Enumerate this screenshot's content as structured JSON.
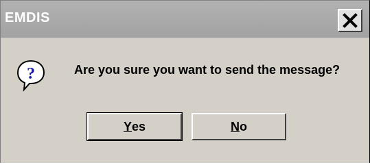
{
  "window": {
    "title": "EMDIS",
    "close_icon": "close-x-icon"
  },
  "message": {
    "icon": "question-icon",
    "text": "Are you sure you want to send the message?"
  },
  "buttons": {
    "yes": {
      "mnemonic": "Y",
      "rest": "es"
    },
    "no": {
      "mnemonic": "N",
      "rest": "o"
    }
  },
  "colors": {
    "titlebar": "#a8a8a8",
    "dialog_bg": "#d4d0c8",
    "icon_blue": "#1a1aa0"
  }
}
